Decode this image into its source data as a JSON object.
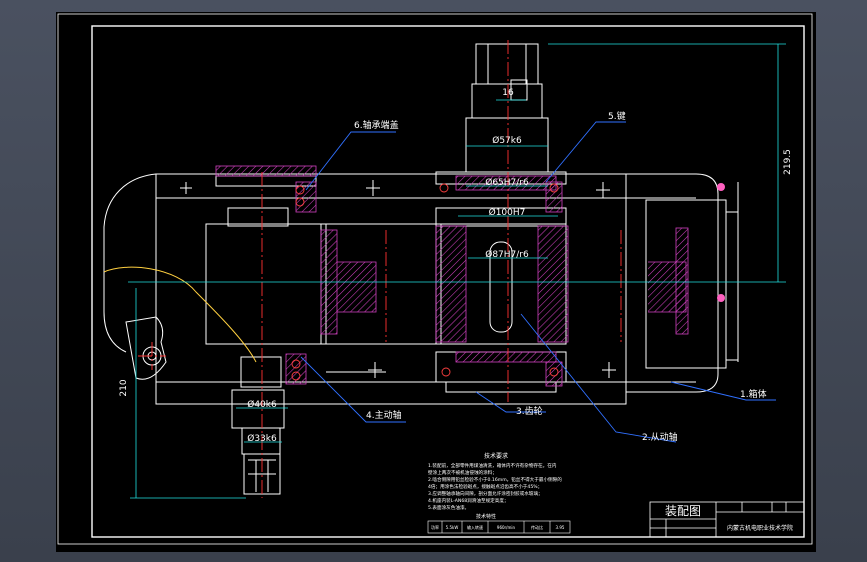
{
  "drawing": {
    "title_block": {
      "name": "装配图",
      "school": "内蒙古机电职业技术学院",
      "cells": [
        "",
        "",
        "",
        ""
      ]
    },
    "part_labels": {
      "casing": "1.箱体",
      "driven_shaft": "2.从动轴",
      "gear": "3.齿轮",
      "driving_shaft": "4.主动轴",
      "key": "5.键",
      "bearing_cap": "6.轴承端盖"
    },
    "dimensions": {
      "key_width": "16",
      "shaft_dia_top": "Ø57k6",
      "bearing_fit": "Ø65H7/r6",
      "bore": "Ø100H7",
      "gear_fit": "Ø87H7/r6",
      "input_dia": "Ø40k6",
      "input_dia2": "Ø33k6",
      "height_right": "219.5",
      "height_left": "210"
    },
    "tech_notes": {
      "title": "技术要求",
      "lines": [
        "1.装配前，全部零件用煤油清洗，箱体内不许有杂物存在。在内",
        "壁涂上两次不被机油侵蚀的涂料；",
        "2.啮合侧隙用铅丝检验不小于0.16mm，铅丝不得大于最小侧隙的",
        "4倍；用涂色法检验斑点，接触斑点沿齿高不小于45%；",
        "3.应调整轴承轴向间隙，剖分面允许涂密封胶或水玻璃；",
        "4.机座内装L-AN68润滑油至规定高度；",
        "5.表面涂灰色油漆。"
      ],
      "table_title": "技术特性",
      "table_cells": [
        "功率",
        "5.5kW",
        "输入转速",
        "960r/min",
        "传动比",
        "3.95"
      ]
    }
  },
  "colors": {
    "outline": "#ffffff",
    "center": "#ff3030",
    "dim": "#20e0e0",
    "hatch": "#d040c0",
    "leader": "#3070ff",
    "frame": "#ffffff"
  }
}
